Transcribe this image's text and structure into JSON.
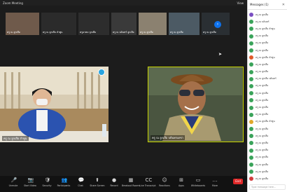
{
  "topbar": {
    "meeting": "Zoom Meeting",
    "view": "View"
  },
  "gallery": [
    {
      "name": "ครู ณ ลูกเสือ",
      "color": "#6f5a4b"
    },
    {
      "name": "ครู ณ ลูกเสือ ลำพูน",
      "color": "#2b2b2b"
    },
    {
      "name": "ครูอาคม ลูกเสือ",
      "color": "#2d2d2d"
    },
    {
      "name": "ครู ณ บดินทร์ ลูกเสือ",
      "color": "#3a3a3a"
    },
    {
      "name": "ครู ณ ลูกเสือ",
      "color": "#8b8170"
    },
    {
      "name": "ครู ณ ลูกเสือ",
      "color": "#4c5a64"
    },
    {
      "name": "ครู ณ ลูกเสือ",
      "color": "#2a2f33"
    }
  ],
  "left_video": {
    "name": "ครู ณ ลูกเสือ ลำพูน"
  },
  "right_video": {
    "name": "ครู ณ ลูกเสือ บดินทรเดชา"
  },
  "chat": {
    "title": "Messages (1)",
    "placeholder": "Type message here...",
    "messages": [
      {
        "text": "ครู ณ ลูกเสือ",
        "color": "#7a4fc2"
      },
      {
        "text": "ครู ณ บดินทร์",
        "color": "#3aa35a"
      },
      {
        "text": "ครู ณ ลูกเสือ ลำพูน",
        "color": "#3aa35a"
      },
      {
        "text": "ครู ณ ลูกเสือ",
        "color": "#3aa35a"
      },
      {
        "text": "ครู ณ ลูกเสือ",
        "color": "#3aa35a"
      },
      {
        "text": "ครู ณ ลูกเสือ",
        "color": "#3aa35a"
      },
      {
        "text": "ครู ณ ลูกเสือ ลำพูน",
        "color": "#e05b2a"
      },
      {
        "text": "ครู ณ ลูกเสือ",
        "color": "#3aa35a"
      },
      {
        "text": "ครู ณ ลูกเสือ",
        "color": "#3aa35a"
      },
      {
        "text": "ครู ณ ลูกเสือ บดินทร์",
        "color": "#3aa35a"
      },
      {
        "text": "ครู ณ ลูกเสือ",
        "color": "#3aa35a"
      },
      {
        "text": "ครู ณ ลูกเสือ",
        "color": "#3aa35a"
      },
      {
        "text": "ครู ณ ลูกเสือ",
        "color": "#3aa35a"
      },
      {
        "text": "ครู ณ ลูกเสือ",
        "color": "#3aa35a"
      },
      {
        "text": "ครู ณ ลูกเสือ",
        "color": "#3aa35a"
      },
      {
        "text": "ครู ณ ลูกเสือ ลำพูน",
        "color": "#e0a82a"
      },
      {
        "text": "ครู ณ ลูกเสือ",
        "color": "#3aa35a"
      },
      {
        "text": "ครู ณ ลูกเสือ",
        "color": "#3aa35a"
      },
      {
        "text": "ครู ณ ลูกเสือ",
        "color": "#3aa35a"
      },
      {
        "text": "ครู ณ ลูกเสือ",
        "color": "#3aa35a"
      },
      {
        "text": "ครู ณ ลูกเสือ",
        "color": "#3aa35a"
      },
      {
        "text": "ครู ณ ลูกเสือ",
        "color": "#3aa35a"
      },
      {
        "text": "ครู ณ ลูกเสือ",
        "color": "#3aa35a"
      },
      {
        "text": "ครู ณ ลูกเสือ",
        "color": "#d23d3d"
      }
    ]
  },
  "toolbar": {
    "buttons": [
      {
        "label": "Unmute",
        "icon": "microphone-icon",
        "glyph": "🎤"
      },
      {
        "label": "Start Video",
        "icon": "camera-icon",
        "glyph": "📷"
      },
      {
        "label": "Security",
        "icon": "shield-icon",
        "glyph": "🛡"
      },
      {
        "label": "Participants",
        "icon": "participants-icon",
        "glyph": "👥"
      },
      {
        "label": "Chat",
        "icon": "chat-icon",
        "glyph": "💬"
      },
      {
        "label": "Share Screen",
        "icon": "share-screen-icon",
        "glyph": "⬆"
      },
      {
        "label": "Record",
        "icon": "record-icon",
        "glyph": "●"
      },
      {
        "label": "Breakout Rooms",
        "icon": "breakout-rooms-icon",
        "glyph": "▦"
      },
      {
        "label": "Live Transcript",
        "icon": "captions-icon",
        "glyph": "CC"
      },
      {
        "label": "Reactions",
        "icon": "reactions-icon",
        "glyph": "☺"
      },
      {
        "label": "Apps",
        "icon": "apps-icon",
        "glyph": "⊞"
      },
      {
        "label": "Whiteboards",
        "icon": "whiteboard-icon",
        "glyph": "▭"
      },
      {
        "label": "More",
        "icon": "more-icon",
        "glyph": "…"
      }
    ],
    "end_label": "End"
  }
}
